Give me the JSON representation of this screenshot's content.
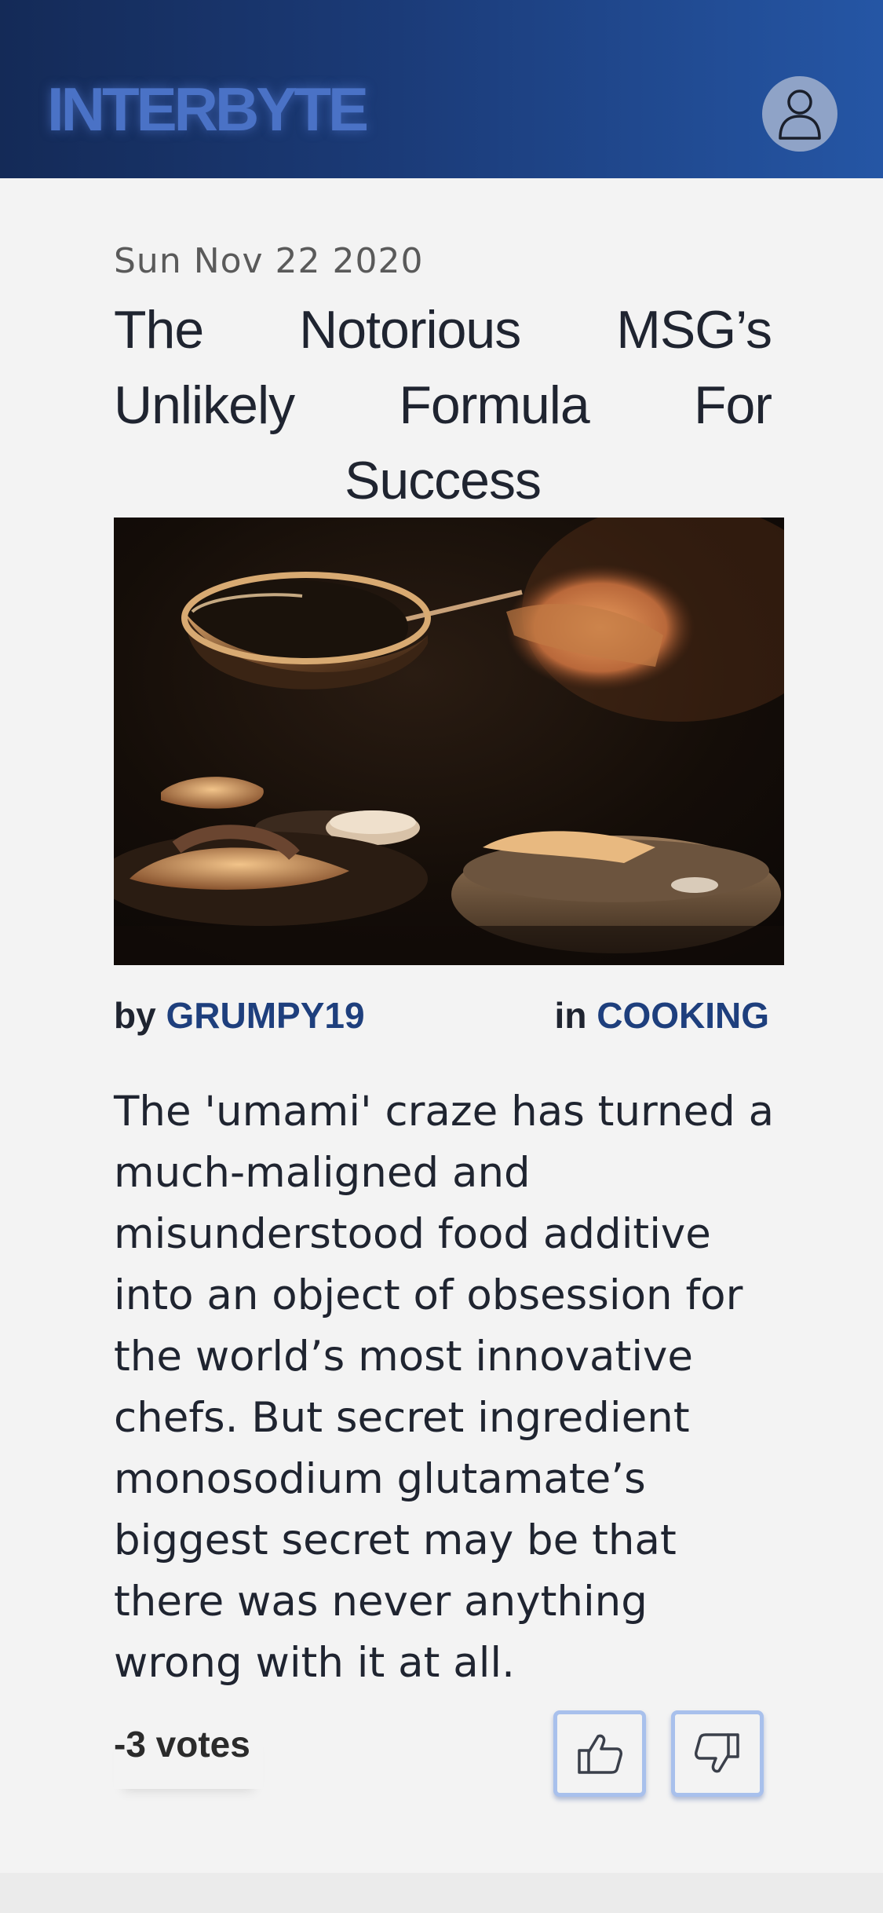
{
  "header": {
    "logo": "INTERBYTE",
    "avatar_icon": "user-icon"
  },
  "article": {
    "date": "Sun Nov 22 2020",
    "title": "The Notorious MSG’s Unlikely Formula For Success",
    "image_icon": "cooking-photo",
    "by_label": "by",
    "author": "GRUMPY19",
    "in_label": "in",
    "category": "COOKING",
    "body": "The 'umami' craze has turned a much-maligned and misunderstood food additive into an object of obsession for the world’s most innovative chefs. But secret ingredient monosodium glutamate’s biggest secret may be that there was never anything wrong with it at all.",
    "votes": "-3 votes",
    "upvote_icon": "thumbs-up-icon",
    "downvote_icon": "thumbs-down-icon"
  },
  "colors": {
    "header_start": "#142a57",
    "header_end": "#2556a5",
    "logo": "#4a72c6",
    "link": "#1e3f7d",
    "vote_border": "#a8c0ec"
  }
}
